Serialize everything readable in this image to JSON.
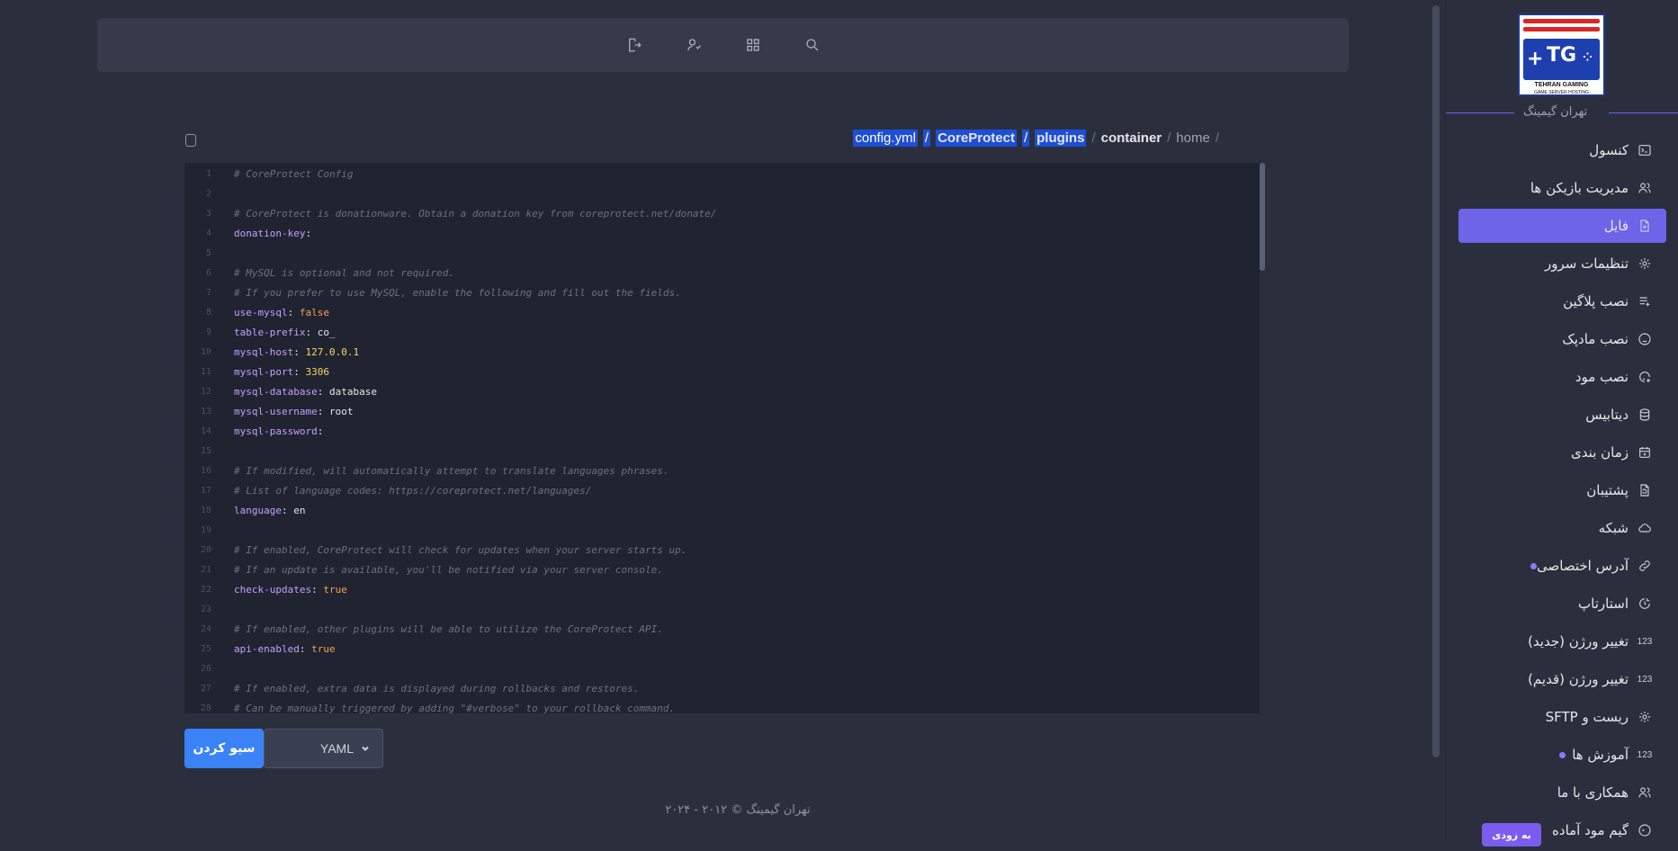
{
  "topbar": {
    "icons": [
      "exit-icon",
      "user-icon",
      "grid-icon",
      "search-icon"
    ]
  },
  "breadcrumb": {
    "parts": [
      "home",
      "container",
      "plugins",
      "CoreProtect",
      "config.yml"
    ]
  },
  "editor": {
    "lines": [
      {
        "n": "1",
        "comment": "# CoreProtect Config"
      },
      {
        "n": "2"
      },
      {
        "n": "3",
        "comment": "# CoreProtect is donationware. Obtain a donation key from coreprotect.net/donate/"
      },
      {
        "n": "4",
        "key": "donation-key"
      },
      {
        "n": "5"
      },
      {
        "n": "6",
        "comment": "# MySQL is optional and not required."
      },
      {
        "n": "7",
        "comment": "# If you prefer to use MySQL, enable the following and fill out the fields."
      },
      {
        "n": "8",
        "key": "use-mysql",
        "value": "false",
        "vtype": "bool"
      },
      {
        "n": "9",
        "key": "table-prefix",
        "value": "co_",
        "vtype": "str"
      },
      {
        "n": "10",
        "key": "mysql-host",
        "value": "127.0.0.1",
        "vtype": "num"
      },
      {
        "n": "11",
        "key": "mysql-port",
        "value": "3306",
        "vtype": "num"
      },
      {
        "n": "12",
        "key": "mysql-database",
        "value": "database",
        "vtype": "str"
      },
      {
        "n": "13",
        "key": "mysql-username",
        "value": "root",
        "vtype": "str"
      },
      {
        "n": "14",
        "key": "mysql-password"
      },
      {
        "n": "15"
      },
      {
        "n": "16",
        "comment": "# If modified, will automatically attempt to translate languages phrases."
      },
      {
        "n": "17",
        "comment": "# List of language codes: https://coreprotect.net/languages/"
      },
      {
        "n": "18",
        "key": "language",
        "value": "en",
        "vtype": "str"
      },
      {
        "n": "19"
      },
      {
        "n": "20",
        "comment": "# If enabled, CoreProtect will check for updates when your server starts up."
      },
      {
        "n": "21",
        "comment": "# If an update is available, you'll be notified via your server console."
      },
      {
        "n": "22",
        "key": "check-updates",
        "value": "true",
        "vtype": "bool"
      },
      {
        "n": "23"
      },
      {
        "n": "24",
        "comment": "# If enabled, other plugins will be able to utilize the CoreProtect API."
      },
      {
        "n": "25",
        "key": "api-enabled",
        "value": "true",
        "vtype": "bool"
      },
      {
        "n": "26"
      },
      {
        "n": "27",
        "comment": "# If enabled, extra data is displayed during rollbacks and restores."
      },
      {
        "n": "28",
        "comment": "# Can be manually triggered by adding \"#verbose\" to your rollback command."
      }
    ]
  },
  "controls": {
    "save_label": "سیو کردن",
    "language": "YAML"
  },
  "footer": "تهران گیمینگ © ۲۰۱۲ - ۲۰۲۴",
  "sidebar": {
    "logo_caption": "TEHRAN GAMING",
    "logo_subcaption": "GAME SERVER HOSTING",
    "brand": "تهران گیمینگ",
    "items": [
      {
        "label": "کنسول",
        "icon": "terminal-icon"
      },
      {
        "label": "مدیریت بازیکن ها",
        "icon": "users-icon"
      },
      {
        "label": "فایل",
        "icon": "file-icon",
        "active": true
      },
      {
        "label": "تنظیمات سرور",
        "icon": "gear-icon"
      },
      {
        "label": "نصب پلاگین",
        "icon": "playlist-add-icon"
      },
      {
        "label": "نصب مادپک",
        "icon": "mood-icon"
      },
      {
        "label": "نصب مود",
        "icon": "mood-plus-icon"
      },
      {
        "label": "دیتابیس",
        "icon": "database-icon"
      },
      {
        "label": "زمان بندی",
        "icon": "calendar-icon"
      },
      {
        "label": "پشتیبان",
        "icon": "file-restore-icon"
      },
      {
        "label": "شبکه",
        "icon": "cloud-icon"
      },
      {
        "label": "آدرس اختصاصی",
        "icon": "link-icon",
        "dot": true
      },
      {
        "label": "استارتاپ",
        "icon": "startup-icon"
      },
      {
        "label": "تغییر ورژن (جدید)",
        "icon": "numbers-icon"
      },
      {
        "label": "تغییر ورژن (قدیم)",
        "icon": "numbers-icon"
      },
      {
        "label": "ریست و SFTP",
        "icon": "gear-icon"
      },
      {
        "label": "آموزش ها",
        "icon": "numbers-icon",
        "dot": true
      },
      {
        "label": "همکاری با ما",
        "icon": "users-icon"
      },
      {
        "label": "گیم مود آماده",
        "icon": "gamepad-icon"
      }
    ],
    "soon_badge": "به زودی",
    "colors": {
      "active": "#6d64e8",
      "accent": "#6366f1"
    }
  }
}
